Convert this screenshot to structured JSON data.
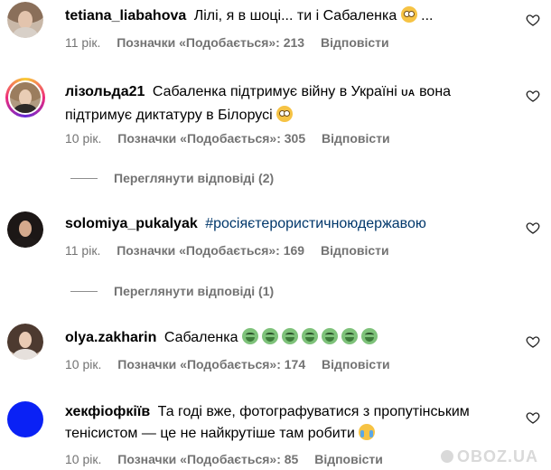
{
  "comments": [
    {
      "username": "tetiana_liabahova",
      "text": "Лілі, я в шоці... ти і Сабаленка",
      "text_suffix": " ...",
      "time": "11 рік.",
      "likes": "Позначки «Подобається»: 213",
      "reply": "Відповісти"
    },
    {
      "username": "лізольда21",
      "text": "Сабаленка підтримує війну в Україні",
      "flag": "UA",
      "text2": "вона підтримує диктатуру в Білорусі",
      "time": "10 рік.",
      "likes": "Позначки «Подобається»: 305",
      "reply": "Відповісти",
      "view_replies": "Переглянути відповіді (2)"
    },
    {
      "username": "solomiya_pukalyak",
      "hashtag": "#росіяєтерористичноюдержавою",
      "time": "11 рік.",
      "likes": "Позначки «Подобається»: 169",
      "reply": "Відповісти",
      "view_replies": "Переглянути відповіді (1)"
    },
    {
      "username": "olya.zakharin",
      "text": "Сабаленка",
      "time": "10 рік.",
      "likes": "Позначки «Подобається»: 174",
      "reply": "Відповісти"
    },
    {
      "username": "хекфіофкіїв",
      "text": "Та годі вже, фотографуватися з пропутінським тенісистом — це не найкрутіше там робити",
      "time": "10 рік.",
      "likes": "Позначки «Подобається»: 85",
      "reply": "Відповісти"
    }
  ],
  "watermark": "OBOZ.UA",
  "colors": {
    "hashtag": "#00376b",
    "meta": "#737373",
    "blue_avatar": "#0a21f5"
  }
}
